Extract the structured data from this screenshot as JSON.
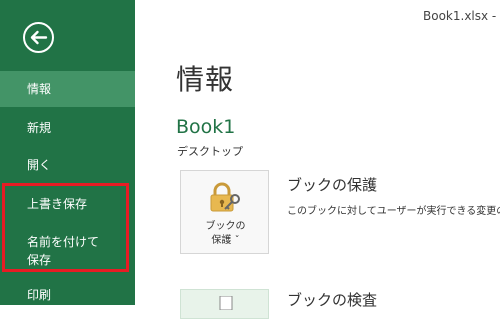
{
  "window": {
    "title": "Book1.xlsx -"
  },
  "sidebar": {
    "items": [
      {
        "label": "情報"
      },
      {
        "label": "新規"
      },
      {
        "label": "開く"
      },
      {
        "label": "上書き保存"
      },
      {
        "label": "名前を付けて"
      },
      {
        "label": "保存"
      },
      {
        "label": "印刷"
      }
    ]
  },
  "main": {
    "page_title": "情報",
    "doc_name": "Book1",
    "doc_location": "デスクトップ",
    "protect": {
      "button_line1": "ブックの",
      "button_line2": "保護 ˇ",
      "heading": "ブックの保護",
      "description": "このブックに対してユーザーが実行できる変更の"
    },
    "inspect": {
      "heading": "ブックの検査"
    }
  },
  "colors": {
    "sidebar_bg": "#217346",
    "active_item_bg": "#439467",
    "highlight_border": "#e81c24"
  }
}
